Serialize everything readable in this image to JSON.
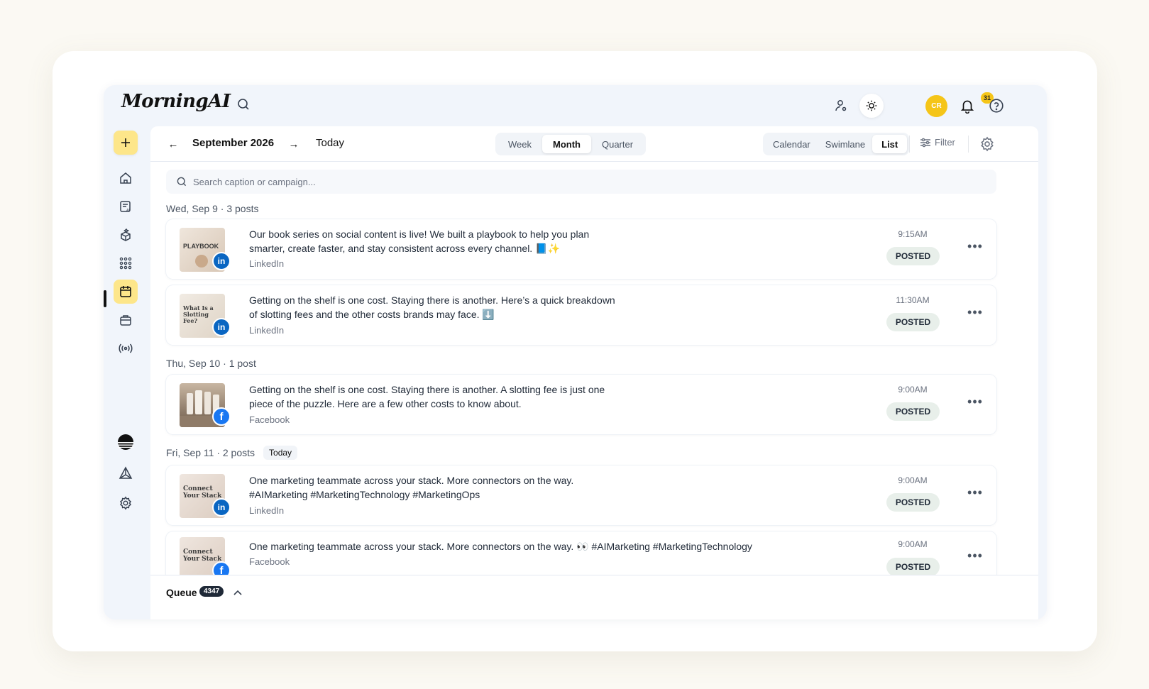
{
  "app": {
    "logo": "MorningAI"
  },
  "header": {
    "avatar_initials": "CR",
    "notifications_count": "31",
    "accent_color": "#f5c518"
  },
  "sidebar": {
    "items": [
      {
        "name": "add",
        "icon": "plus-icon"
      },
      {
        "name": "home",
        "icon": "home-icon"
      },
      {
        "name": "ai-content",
        "icon": "ai-document-icon"
      },
      {
        "name": "brand",
        "icon": "cube-sparkle-icon"
      },
      {
        "name": "apps",
        "icon": "grid-icon"
      },
      {
        "name": "calendar",
        "icon": "calendar-icon",
        "active": true
      },
      {
        "name": "inbox",
        "icon": "briefcase-icon"
      },
      {
        "name": "broadcast",
        "icon": "broadcast-icon"
      },
      {
        "name": "workspace",
        "icon": "sunset-logo-icon"
      },
      {
        "name": "integrations",
        "icon": "triangle-icon"
      },
      {
        "name": "settings",
        "icon": "gear-icon"
      }
    ]
  },
  "toolbar": {
    "month": "September 2026",
    "today": "Today",
    "ranges": [
      "Week",
      "Month",
      "Quarter"
    ],
    "active_range": "Month",
    "views": [
      "Calendar",
      "Swimlane",
      "List"
    ],
    "active_view": "List",
    "filter": "Filter"
  },
  "search": {
    "placeholder": "Search caption or campaign..."
  },
  "days": [
    {
      "header": "Wed, Sep 9 · 3 posts",
      "posts": [
        {
          "text_line1": "Our book series on social content is live! We built a playbook to help you plan",
          "text_line2": "smarter, create faster, and stay consistent across every channel. 📘✨",
          "network": "LinkedIn",
          "time": "9:15AM",
          "status": "POSTED",
          "thumb_label": "PLAYBOOK"
        },
        {
          "text_line1": "Getting on the shelf is one cost. Staying there is another. Here’s a quick breakdown",
          "text_line2": "of slotting fees and the other costs brands may face. ⬇️",
          "network": "LinkedIn",
          "time": "11:30AM",
          "status": "POSTED",
          "thumb_label": "What Is a Slotting Fee?"
        }
      ]
    },
    {
      "header": "Thu, Sep 10 · 1 post",
      "posts": [
        {
          "text_line1": "Getting on the shelf is one cost. Staying there is another. A slotting fee is just one",
          "text_line2": "piece of the puzzle. Here are a few other costs to know about.",
          "network": "Facebook",
          "time": "9:00AM",
          "status": "POSTED"
        }
      ]
    },
    {
      "header": "Fri, Sep 11 · 2 posts",
      "badge": "Today",
      "posts": [
        {
          "text_line1": "One marketing teammate across your stack. More connectors on the way.",
          "text_line2": "#AIMarketing #MarketingTechnology #MarketingOps",
          "network": "LinkedIn",
          "time": "9:00AM",
          "status": "POSTED",
          "thumb_label": "Connect Your Stack"
        },
        {
          "text_line1": "One marketing teammate across your stack. More connectors on the way. 👀 #AIMarketing #MarketingTechnology",
          "text_line2": "",
          "network": "Facebook",
          "time": "9:00AM",
          "status": "POSTED",
          "thumb_label": "Connect Your Stack"
        }
      ]
    }
  ],
  "queue": {
    "label": "Queue",
    "count": "4347"
  }
}
